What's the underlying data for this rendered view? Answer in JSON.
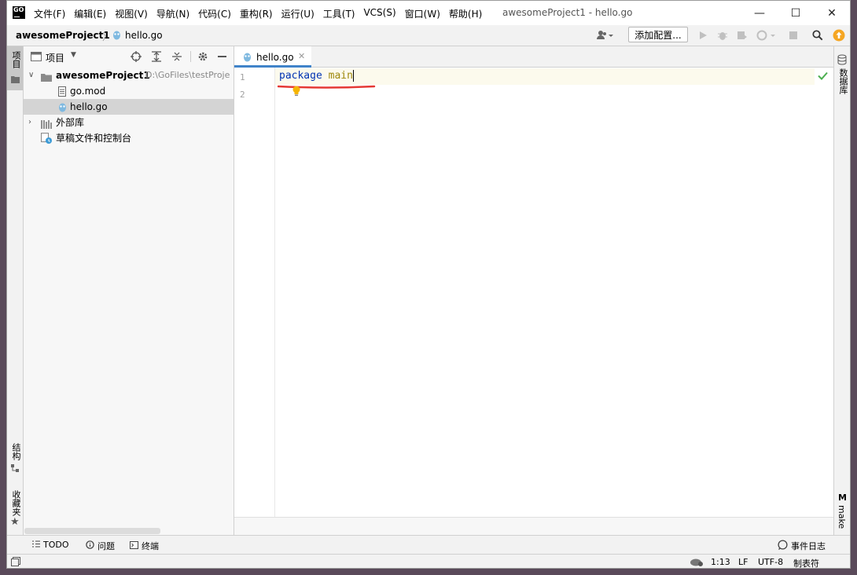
{
  "app": {
    "logo": "GO",
    "window_title": "awesomeProject1 - hello.go"
  },
  "menu": [
    "文件(F)",
    "编辑(E)",
    "视图(V)",
    "导航(N)",
    "代码(C)",
    "重构(R)",
    "运行(U)",
    "工具(T)",
    "VCS(S)",
    "窗口(W)",
    "帮助(H)"
  ],
  "window_controls": {
    "minimize": "—",
    "maximize": "☐",
    "close": "✕"
  },
  "navbar": {
    "project": "awesomeProject1",
    "file": "hello.go",
    "add_config": "添加配置..."
  },
  "left_tabs": {
    "project": "项目",
    "structure": "结构",
    "favorites": "收藏夹"
  },
  "right_tabs": {
    "database": "数据库",
    "make": "make"
  },
  "project_panel": {
    "title": "项目",
    "root": {
      "name": "awesomeProject1",
      "path": "D:\\GoFiles\\testProje"
    },
    "files": [
      "go.mod",
      "hello.go"
    ],
    "external_libs": "外部库",
    "scratches": "草稿文件和控制台"
  },
  "editor": {
    "tab": "hello.go",
    "line_numbers": [
      "1",
      "2"
    ],
    "code": {
      "keyword": "package",
      "name": "main"
    }
  },
  "bottom_tools": {
    "todo": "TODO",
    "problems": "问题",
    "terminal": "终端",
    "event_log": "事件日志"
  },
  "status": {
    "position": "1:13",
    "line_sep": "LF",
    "encoding": "UTF-8",
    "indent": "制表符"
  },
  "colors": {
    "accent": "#4083c9",
    "keyword": "#0033b3",
    "identifier": "#9e880d",
    "error_underline": "#e53935",
    "update_badge": "#f5a623"
  }
}
